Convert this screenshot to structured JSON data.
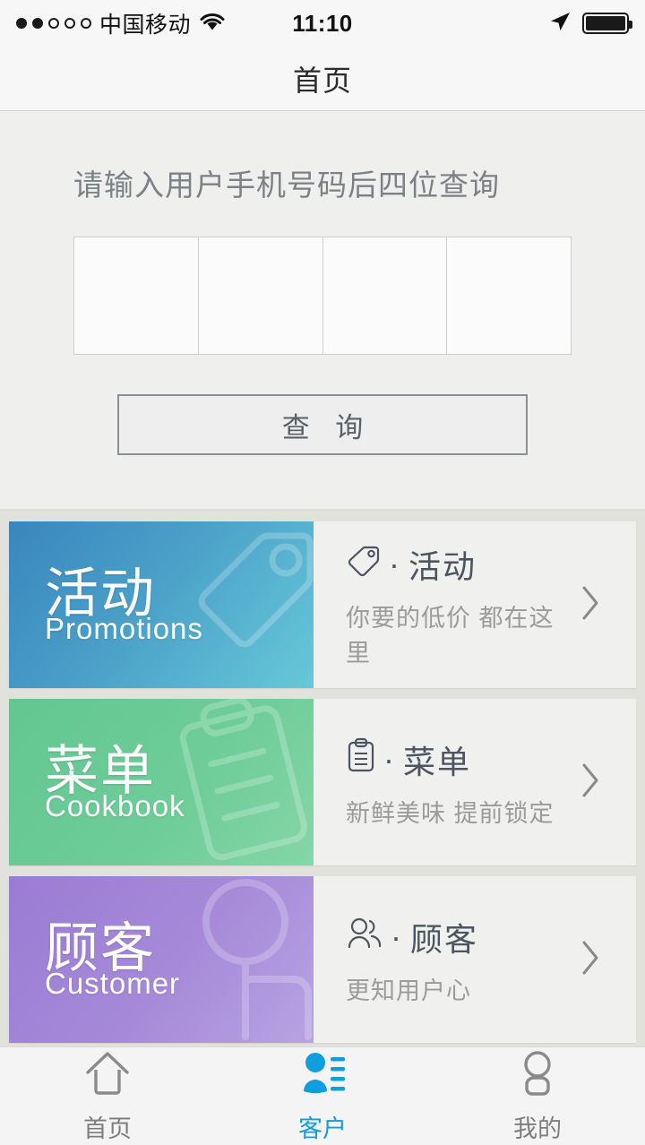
{
  "status_bar": {
    "signal_dots": [
      true,
      true,
      false,
      false,
      false
    ],
    "carrier": "中国移动",
    "wifi_icon": "wifi-icon",
    "time": "11:10",
    "location_icon": "location-arrow-icon",
    "battery_icon": "battery-full-icon"
  },
  "nav": {
    "title": "首页"
  },
  "search": {
    "label": "请输入用户手机号码后四位查询",
    "digits": [
      "",
      "",
      "",
      ""
    ],
    "digit_count": 4,
    "button_label": "查 询"
  },
  "cards": [
    {
      "banner_cn": "活动",
      "banner_en": "Promotions",
      "banner_color_start": "#3a86bd",
      "banner_color_end": "#67c8d8",
      "watermark_icon": "tag-icon",
      "icon": "tag-icon",
      "separator": "·",
      "title": "活动",
      "subtitle": "你要的低价 都在这里",
      "chevron_icon": "chevron-right-icon"
    },
    {
      "banner_cn": "菜单",
      "banner_en": "Cookbook",
      "banner_color_start": "#63c691",
      "banner_color_end": "#86d6a8",
      "watermark_icon": "clipboard-icon",
      "icon": "clipboard-icon",
      "separator": "·",
      "title": "菜单",
      "subtitle": "新鲜美味 提前锁定",
      "chevron_icon": "chevron-right-icon"
    },
    {
      "banner_cn": "顾客",
      "banner_en": "Customer",
      "banner_color_start": "#9a7cd3",
      "banner_color_end": "#b8a3e2",
      "watermark_icon": "person-search-icon",
      "icon": "two-people-icon",
      "separator": "·",
      "title": "顾客",
      "subtitle": "更知用户心",
      "chevron_icon": "chevron-right-icon"
    }
  ],
  "tabbar": {
    "active_color": "#0e9fdc",
    "inactive_color": "#7d7d7d",
    "tabs": [
      {
        "label": "首页",
        "icon": "home-icon",
        "active": false
      },
      {
        "label": "客户",
        "icon": "customer-icon",
        "active": true
      },
      {
        "label": "我的",
        "icon": "profile-icon",
        "active": false
      }
    ]
  }
}
